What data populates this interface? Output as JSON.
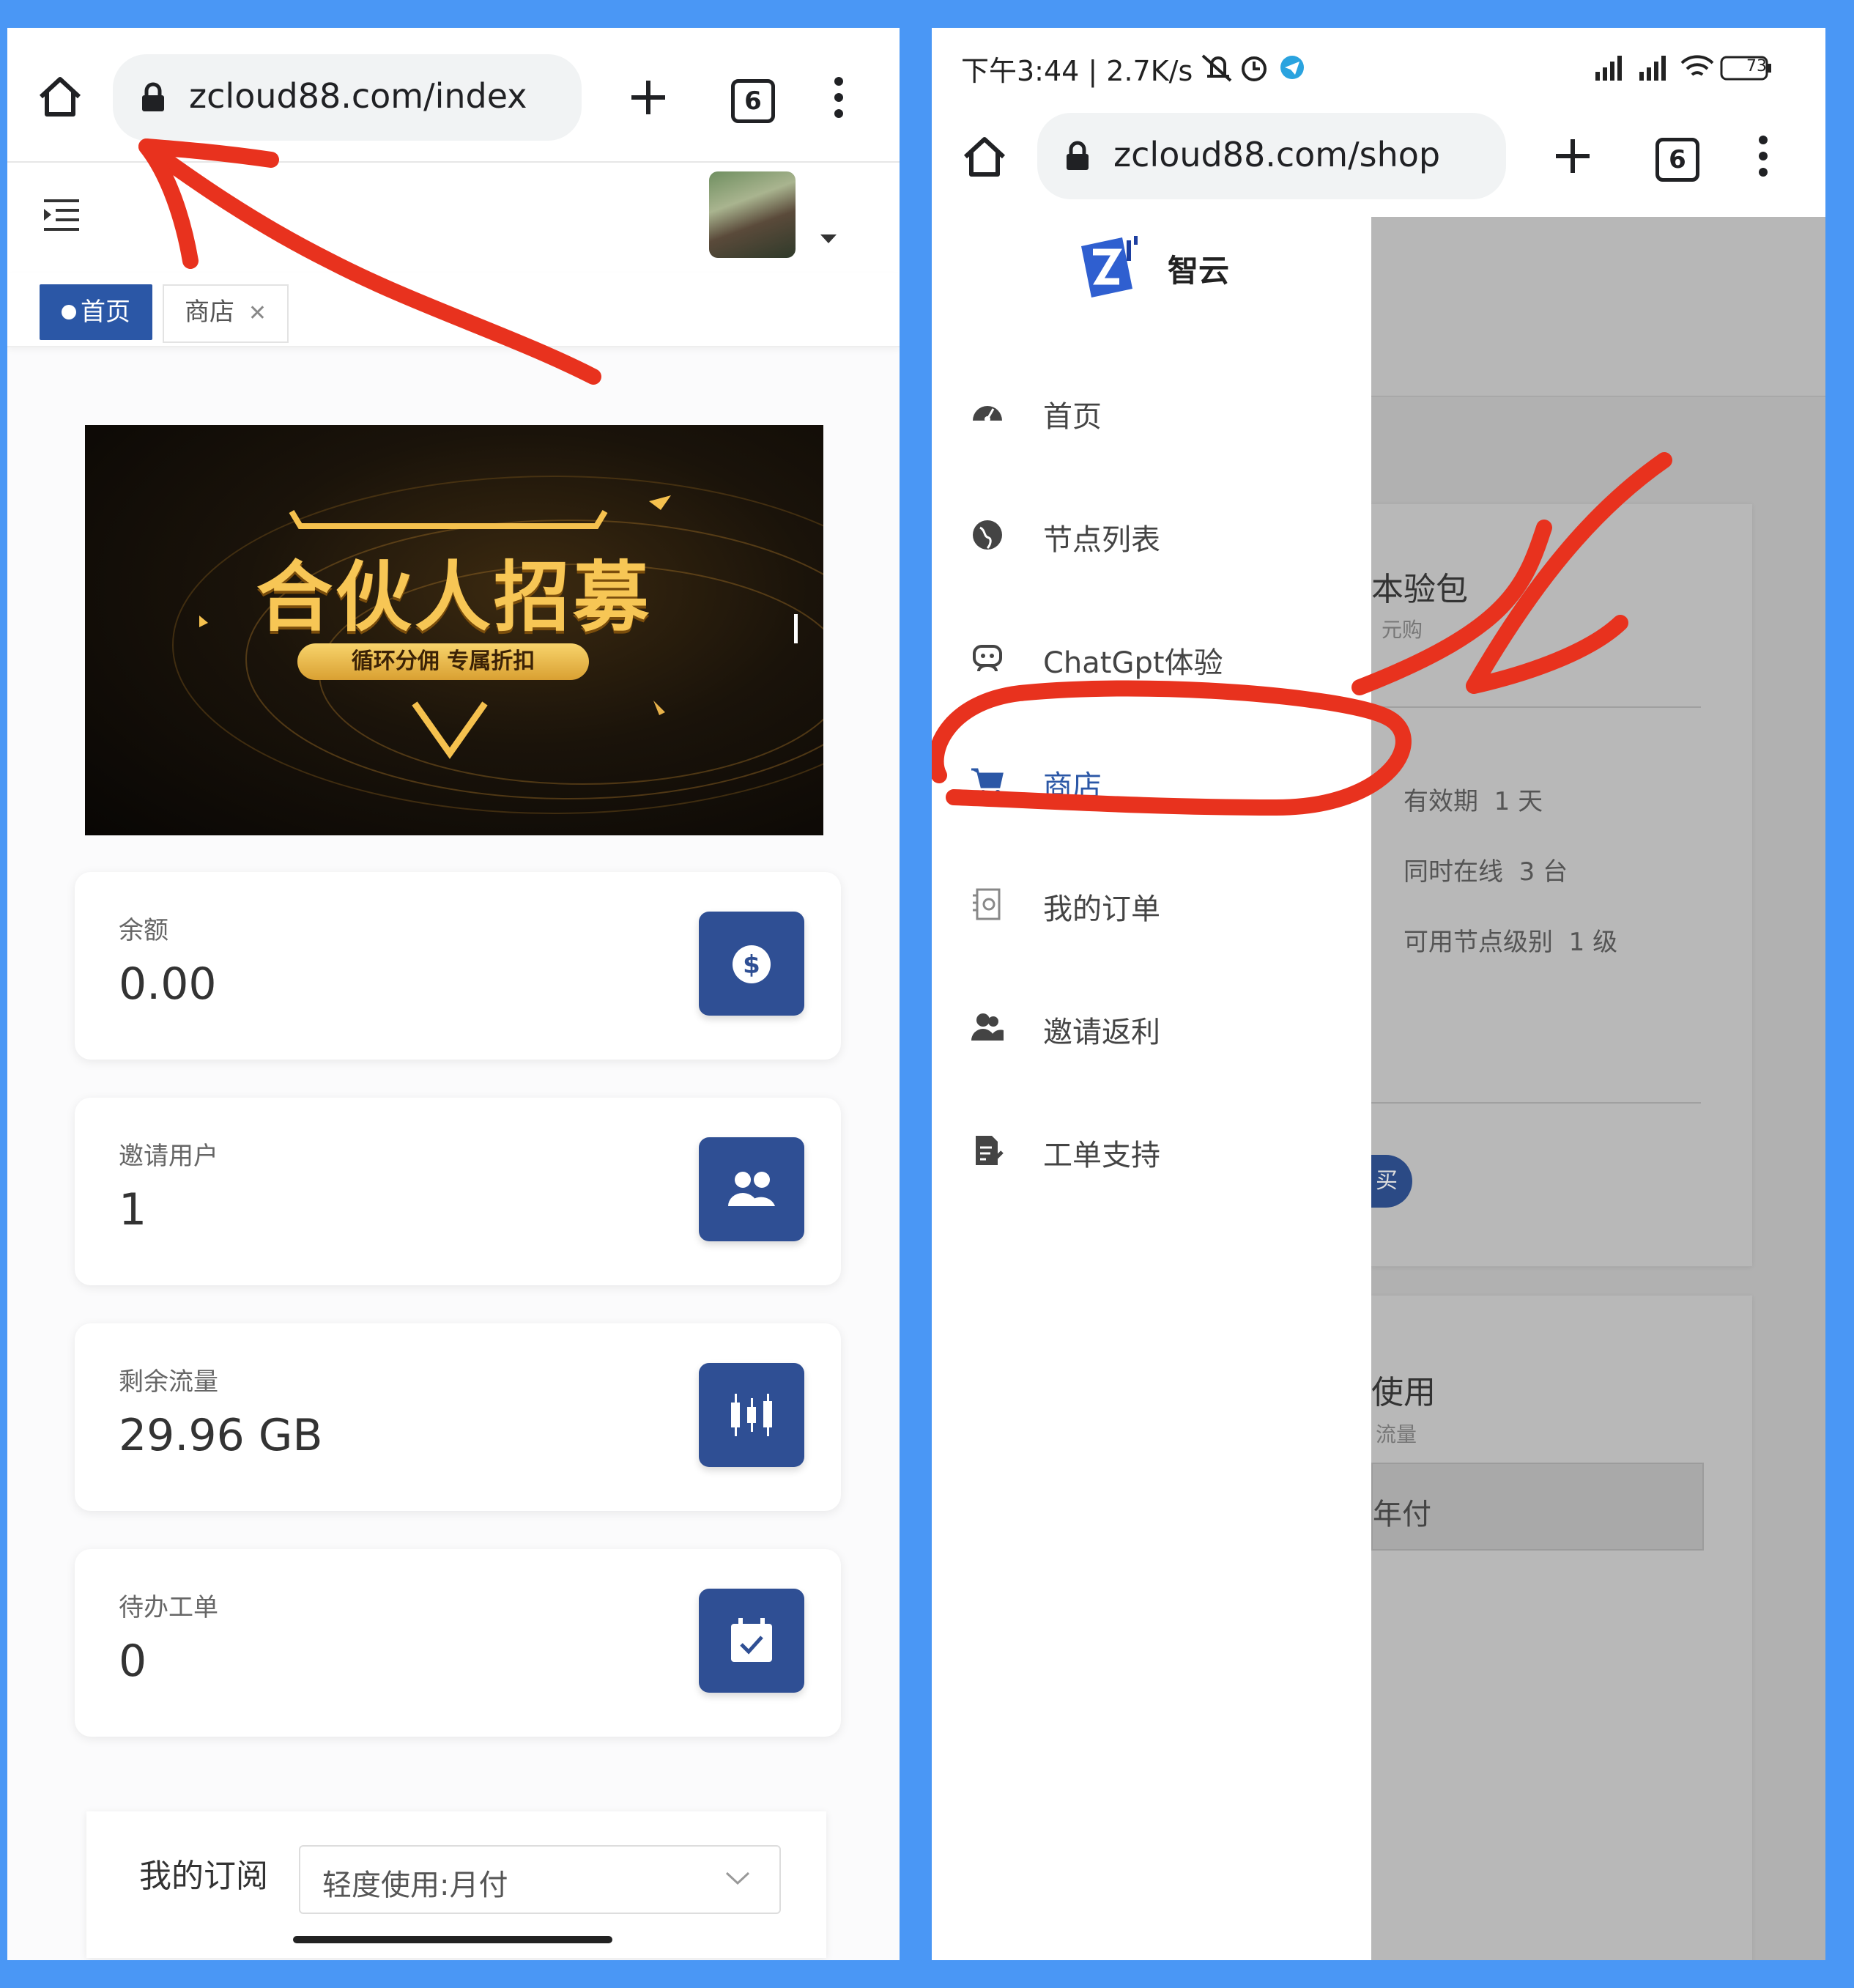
{
  "left": {
    "browser": {
      "url": "zcloud88.com/index",
      "tab_count": "6"
    },
    "tabs": [
      {
        "label": "首页",
        "active": true
      },
      {
        "label": "商店",
        "active": false
      }
    ],
    "banner": {
      "title": "合伙人招募",
      "subtitle": "循环分佣 专属折扣"
    },
    "stats": [
      {
        "label": "余额",
        "value": "0.00",
        "icon": "dollar-icon"
      },
      {
        "label": "邀请用户",
        "value": "1",
        "icon": "users-icon"
      },
      {
        "label": "剩余流量",
        "value": "29.96 GB",
        "icon": "traffic-icon"
      },
      {
        "label": "待办工单",
        "value": "0",
        "icon": "calendar-check-icon"
      }
    ],
    "subscription": {
      "label": "我的订阅",
      "selected": "轻度使用:月付"
    }
  },
  "right": {
    "status": {
      "text": "下午3:44 | 2.7K/s",
      "battery": "73"
    },
    "browser": {
      "url": "zcloud88.com/shop",
      "tab_count": "6"
    },
    "brand": "智云",
    "menu": [
      {
        "label": "首页",
        "icon": "dashboard-icon"
      },
      {
        "label": "节点列表",
        "icon": "globe-icon"
      },
      {
        "label": "ChatGpt体验",
        "icon": "chat-bot-icon"
      },
      {
        "label": "商店",
        "icon": "cart-icon",
        "active": true
      },
      {
        "label": "我的订单",
        "icon": "order-icon"
      },
      {
        "label": "邀请返利",
        "icon": "invite-icon"
      },
      {
        "label": "工单支持",
        "icon": "ticket-icon"
      }
    ],
    "background": {
      "plan_title": "本验包",
      "plan_sub": "元购",
      "specs": [
        {
          "label": "有效期",
          "value": "1 天"
        },
        {
          "label": "同时在线",
          "value": "3 台"
        },
        {
          "label": "可用节点级别",
          "value": "1 级"
        }
      ],
      "buy_button": "买",
      "plan2_title": "使用",
      "plan2_sub": "流量",
      "plan2_option": "年付"
    }
  },
  "colors": {
    "frame": "#4a97f5",
    "primary": "#2b57a6",
    "annotation": "#e8321e"
  }
}
